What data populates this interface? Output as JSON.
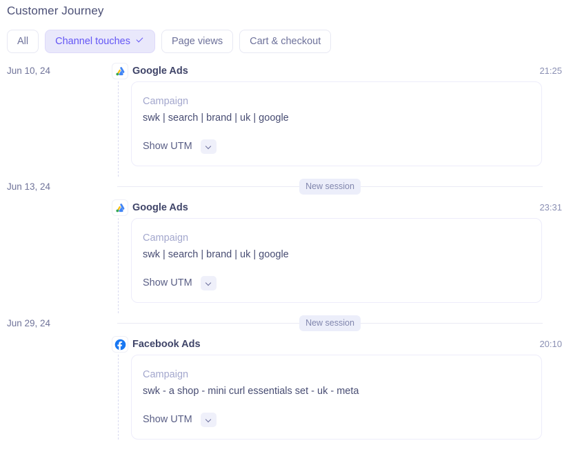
{
  "header": {
    "title": "Customer Journey"
  },
  "filters": [
    {
      "label": "All",
      "active": false,
      "icon": null
    },
    {
      "label": "Channel touches",
      "active": true,
      "icon": "check-icon"
    },
    {
      "label": "Page views",
      "active": false,
      "icon": null
    },
    {
      "label": "Cart & checkout",
      "active": false,
      "icon": null
    }
  ],
  "labels": {
    "new_session": "New session",
    "campaign_field": "Campaign",
    "show_utm": "Show UTM",
    "chevron_icon": "chevron-down-icon"
  },
  "colors": {
    "accent": "#6355f5",
    "accent_bg": "#e9e8fb",
    "text": "#4b4f75",
    "muted": "#8a8fb3",
    "card_border": "#edecfa",
    "divider": "#e9eaf4",
    "badge_bg": "#eceefa",
    "google_blue": "#4285f4",
    "google_yellow": "#fbbc04",
    "google_green": "#34a853",
    "facebook_blue": "#1877f2"
  },
  "timeline": [
    {
      "date": "Jun 10, 24",
      "new_session": false,
      "time": "21:25",
      "channel": "Google Ads",
      "channel_icon": "google-ads-icon",
      "campaign_label": "Campaign",
      "campaign_value": "swk | search | brand | uk | google",
      "show_utm": "Show UTM"
    },
    {
      "date": "Jun 13, 24",
      "new_session": true,
      "session_label": "New session",
      "time": "23:31",
      "channel": "Google Ads",
      "channel_icon": "google-ads-icon",
      "campaign_label": "Campaign",
      "campaign_value": "swk | search | brand | uk | google",
      "show_utm": "Show UTM"
    },
    {
      "date": "Jun 29, 24",
      "new_session": true,
      "session_label": "New session",
      "time": "20:10",
      "channel": "Facebook Ads",
      "channel_icon": "facebook-icon",
      "campaign_label": "Campaign",
      "campaign_value": "swk - a shop - mini curl essentials set - uk - meta",
      "show_utm": "Show UTM"
    }
  ]
}
